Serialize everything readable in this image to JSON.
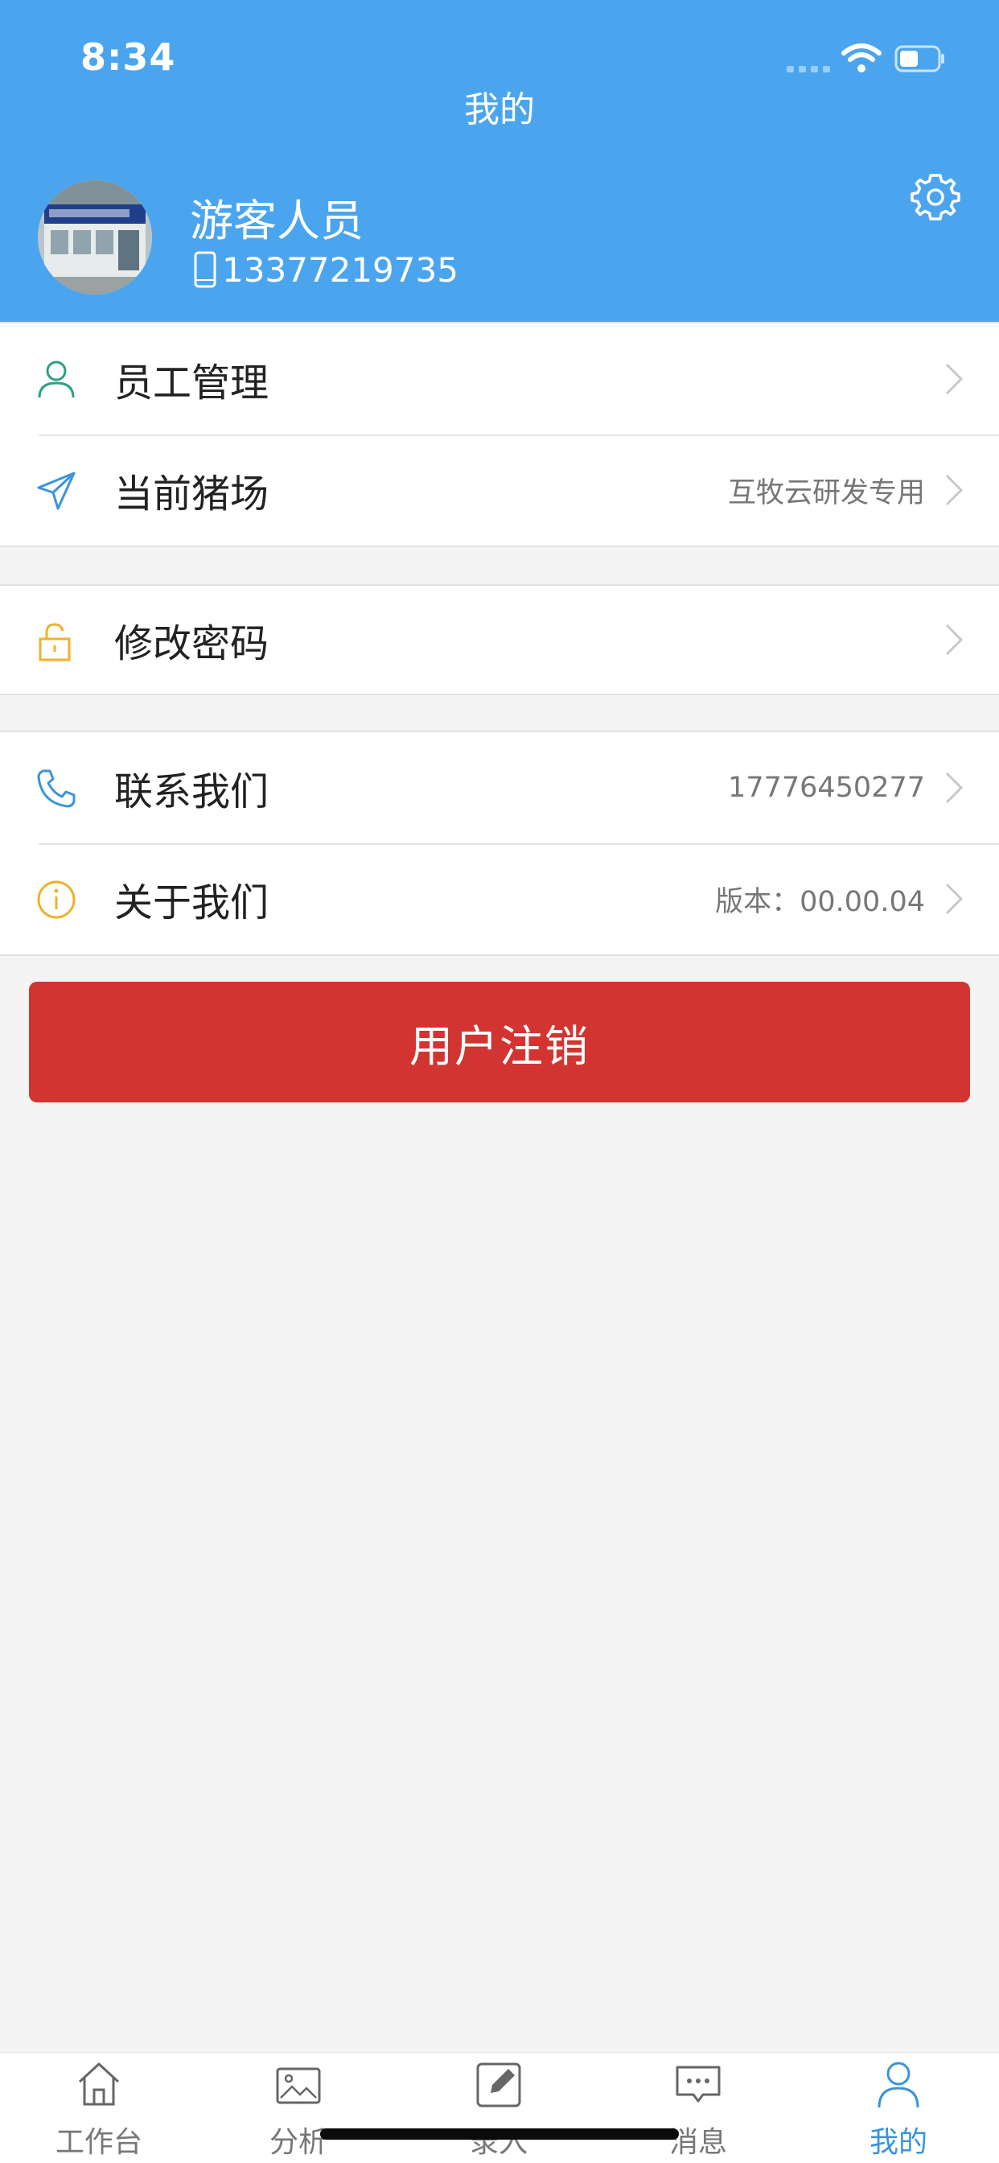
{
  "status_bar": {
    "time": "8:34"
  },
  "header": {
    "title": "我的"
  },
  "profile": {
    "name": "游客人员",
    "phone": "13377219735"
  },
  "sections": [
    {
      "rows": [
        {
          "label": "员工管理",
          "value": "",
          "icon": "person-icon"
        },
        {
          "label": "当前猪场",
          "value": "互牧云研发专用",
          "icon": "navigation-arrow-icon"
        }
      ]
    },
    {
      "rows": [
        {
          "label": "修改密码",
          "value": "",
          "icon": "unlock-icon"
        }
      ]
    },
    {
      "rows": [
        {
          "label": "联系我们",
          "value": "17776450277",
          "icon": "phone-icon"
        },
        {
          "label": "关于我们",
          "value": "版本：00.00.04",
          "icon": "info-icon"
        }
      ]
    }
  ],
  "logout_button": "用户注销",
  "tabs": [
    {
      "label": "工作台",
      "icon": "home-icon",
      "active": false
    },
    {
      "label": "分析",
      "icon": "image-icon",
      "active": false
    },
    {
      "label": "录入",
      "icon": "edit-icon",
      "active": false
    },
    {
      "label": "消息",
      "icon": "message-icon",
      "active": false
    },
    {
      "label": "我的",
      "icon": "person-icon",
      "active": true
    }
  ],
  "colors": {
    "header": "#4ba5ee",
    "logout": "#d23531",
    "active_tab": "#3b93dc",
    "background": "#f4f4f4"
  }
}
